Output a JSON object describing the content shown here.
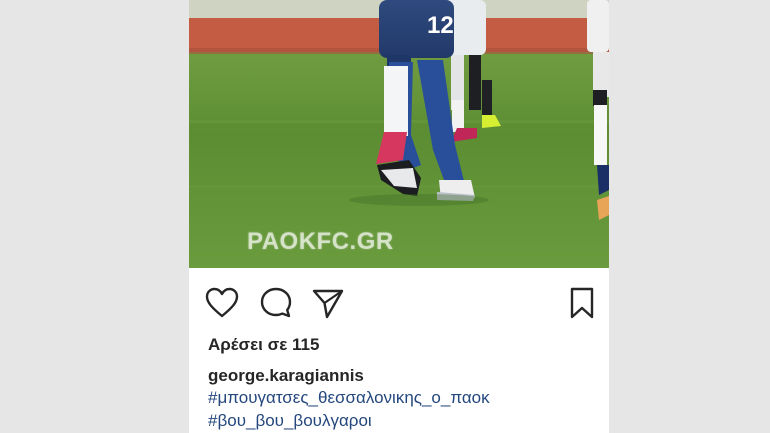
{
  "photo": {
    "watermark": "PAOKFC.GR",
    "jersey_number": "12"
  },
  "actions": {
    "like_icon": "heart-icon",
    "comment_icon": "comment-bubble-icon",
    "share_icon": "paper-plane-icon",
    "save_icon": "bookmark-icon"
  },
  "post": {
    "likes_text": "Αρέσει σε 115",
    "username": "george.karagiannis",
    "hashtags": [
      "#μπουγατσες_θεσσαλονικης_ο_παοκ",
      "#βου_βου_βουλγαροι"
    ]
  },
  "colors": {
    "background": "#e6e6e6",
    "text": "#262626",
    "hashtag": "#24477d",
    "pitch": "#5f8f34"
  }
}
